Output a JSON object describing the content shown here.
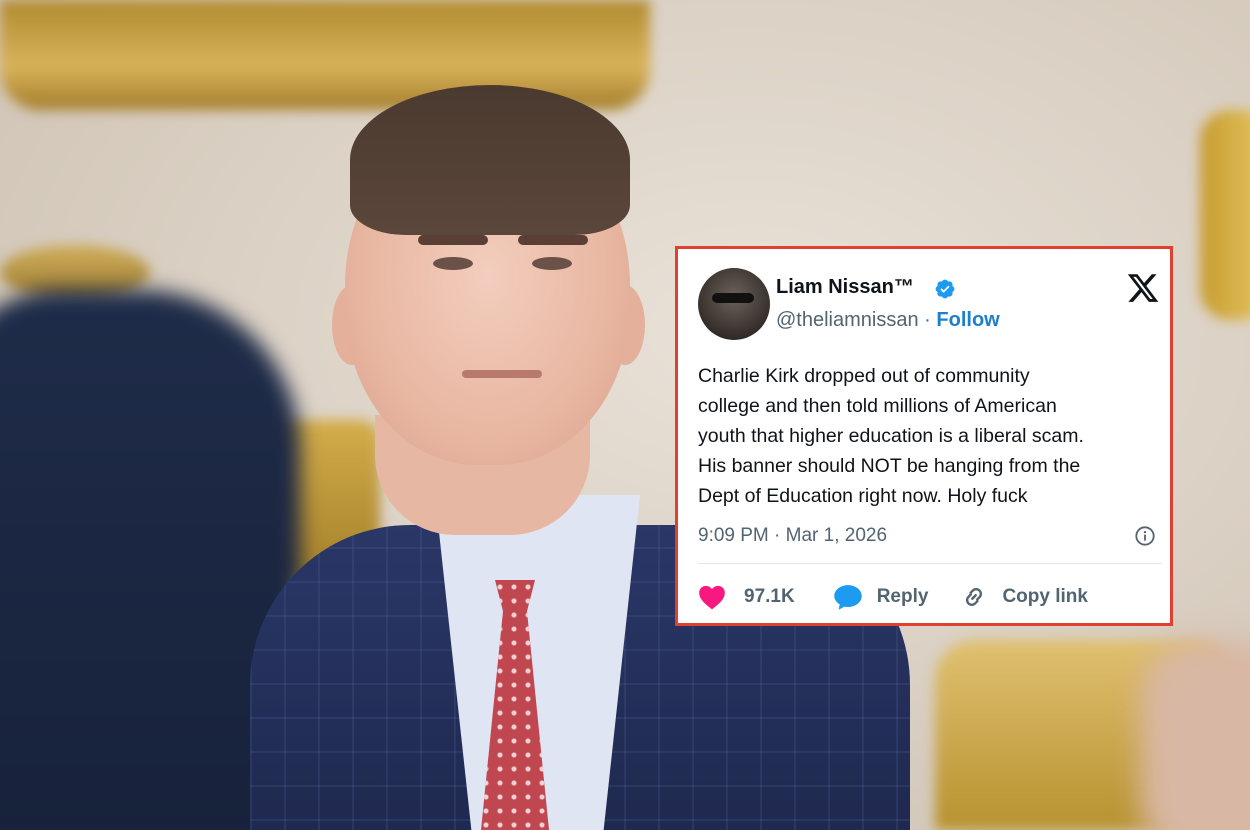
{
  "tweet": {
    "display_name": "Liam Nissan™",
    "handle": "@theliamnissan",
    "separator": "·",
    "follow_label": "Follow",
    "text": "Charlie Kirk dropped out of community\ncollege and then told millions of American\nyouth that higher education is a liberal scam.\nHis banner should NOT be hanging from the\nDept of Education right now. Holy fuck",
    "timestamp": "9:09 PM · Mar 1, 2026",
    "likes": "97.1K",
    "reply_label": "Reply",
    "copy_link_label": "Copy link",
    "colors": {
      "border": "#e0402d",
      "follow": "#1d7fcf",
      "like": "#f91880",
      "reply": "#1d9bf0",
      "verified": "#1d9bf0"
    },
    "icons": [
      "verified-badge-icon",
      "x-logo-icon",
      "info-icon",
      "heart-icon",
      "reply-bubble-icon",
      "link-icon"
    ]
  }
}
